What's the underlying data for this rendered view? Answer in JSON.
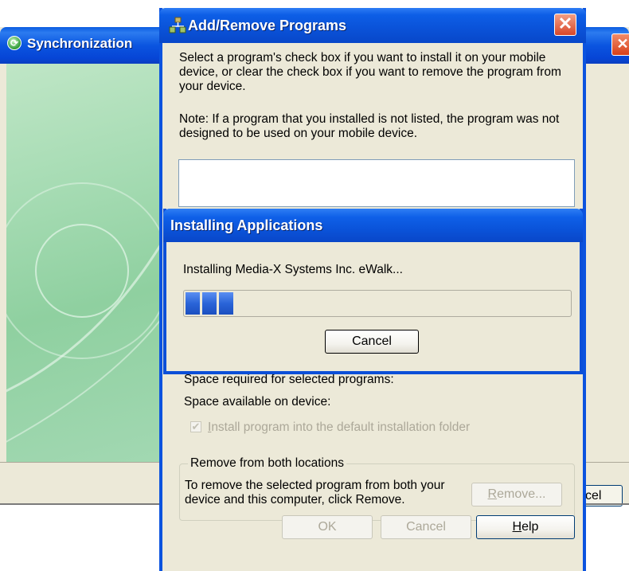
{
  "sync_window": {
    "title": "Synchronization",
    "cancel_label": "cel"
  },
  "add_remove": {
    "title": "Add/Remove Programs",
    "instructions": "Select a program's check box if you want to install it on your mobile device, or clear the check box if you want to remove the program from your device.",
    "note": "Note:  If a program that you installed is not listed, the program was not designed to be used on your mobile device.",
    "space_required_label": "Space required for selected programs:",
    "space_available_label": "Space available on device:",
    "install_default_label": "Install program into the default installation folder",
    "install_default_checked": true,
    "remove_group_title": "Remove from both locations",
    "remove_group_desc": "To remove the selected program from both your device and this computer, click Remove.",
    "remove_button": "Remove...",
    "ok_button": "OK",
    "cancel_button": "Cancel",
    "help_button": "Help"
  },
  "installing": {
    "title": "Installing Applications",
    "message": "Installing Media-X Systems Inc. eWalk...",
    "progress_blocks": 3,
    "cancel_button": "Cancel"
  },
  "colors": {
    "xp_title_blue": "#0a52d8",
    "dialog_face": "#ece9d8",
    "progress_blue": "#2a64d8",
    "close_red": "#d8472a"
  }
}
